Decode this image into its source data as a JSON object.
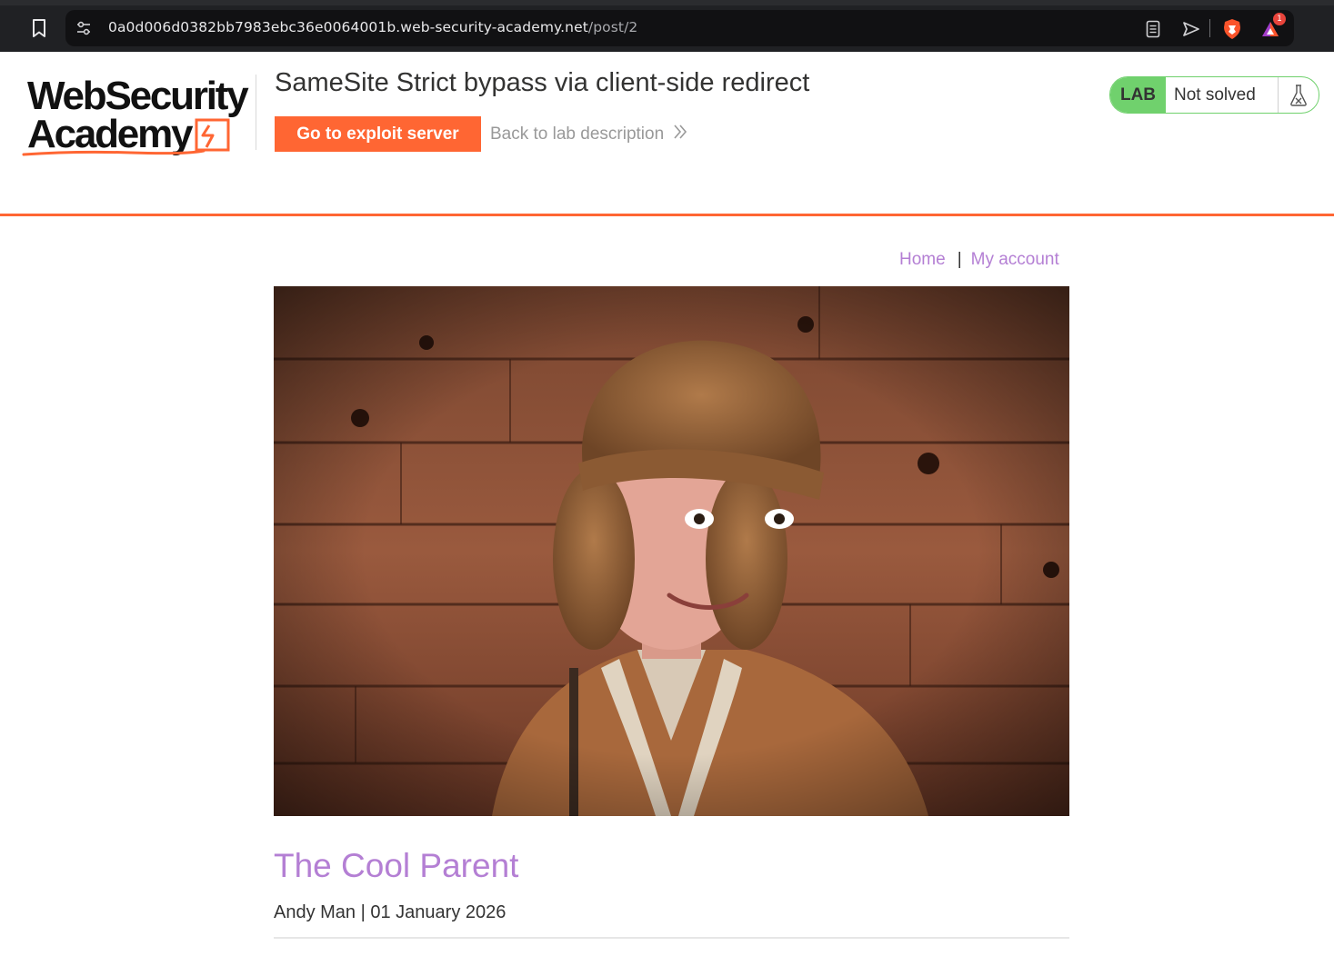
{
  "browser": {
    "url_host": "0a0d006d0382bb7983ebc36e0064001b.web-security-academy.net",
    "url_path": "/post/2",
    "icons": [
      "bookmark-icon",
      "site-info-icon",
      "reader-mode-icon",
      "send-icon",
      "brave-shields-icon",
      "brave-rewards-icon"
    ],
    "notification_count": "1"
  },
  "lab_header": {
    "logo_line1": "WebSecurity",
    "logo_line2": "Academy",
    "title": "SameSite Strict bypass via client-side redirect",
    "exploit_button": "Go to exploit server",
    "back_link": "Back to lab description",
    "status_tag": "LAB",
    "status_text": "Not solved",
    "accent_color": "#ff6633",
    "status_color": "#70d16d"
  },
  "nav": {
    "home": "Home",
    "separator": "|",
    "account": "My account",
    "link_color": "#b47fd4"
  },
  "post": {
    "title": "The Cool Parent",
    "meta": "Andy Man | 01 January 2026"
  }
}
